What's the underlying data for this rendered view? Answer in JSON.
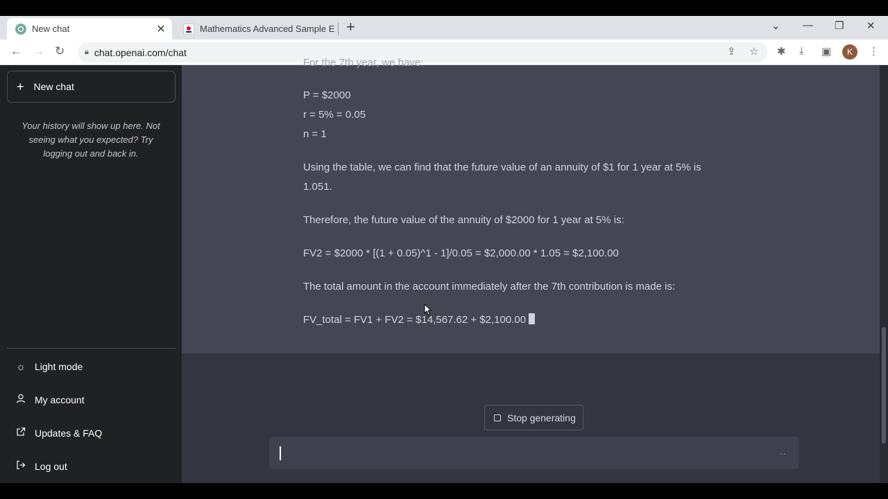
{
  "browser": {
    "tabs": [
      {
        "label": "New chat",
        "active": true
      },
      {
        "label": "Mathematics Advanced Sample E",
        "active": false
      }
    ],
    "url": "chat.openai.com/chat",
    "avatar_letter": "K"
  },
  "sidebar": {
    "new_chat_label": "New chat",
    "history_note": "Your history will show up here. Not seeing what you expected? Try logging out and back in.",
    "items": [
      {
        "label": "Light mode",
        "icon": "sun-icon"
      },
      {
        "label": "My account",
        "icon": "user-icon"
      },
      {
        "label": "Updates & FAQ",
        "icon": "external-link-icon"
      },
      {
        "label": "Log out",
        "icon": "logout-icon"
      }
    ]
  },
  "conversation": {
    "lines": [
      "For the 7th year, we have:",
      "P = $2000",
      "r = 5% = 0.05",
      "n = 1",
      "Using the table, we can find that the future value of an annuity of $1 for 1 year at 5% is",
      "1.051.",
      "Therefore, the future value of the annuity of $2000 for 1 year at 5% is:",
      "FV2 = $2000 * [(1 + 0.05)^1 - 1]/0.05 = $2,000.00 * 1.05 = $2,100.00",
      "The total amount in the account immediately after the 7th contribution is made is:",
      "FV_total = FV1 + FV2 = $14,567.62 + $2,100.00"
    ]
  },
  "controls": {
    "stop_label": "Stop generating",
    "input_placeholder": "",
    "input_dots": ".."
  },
  "colors": {
    "sidebar_bg": "#202123",
    "main_bg": "#343541",
    "message_bg": "#444654",
    "input_bg": "#40414f"
  }
}
